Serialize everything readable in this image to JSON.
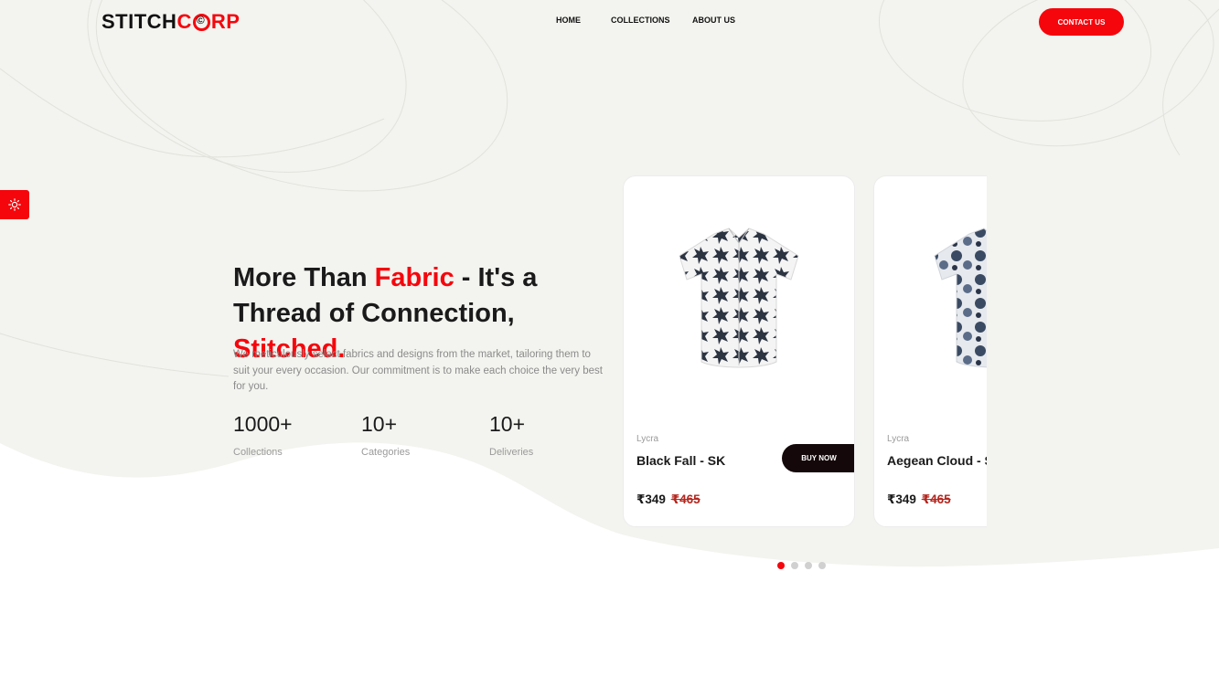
{
  "brand": {
    "logo_left": "STITCH",
    "logo_right_pre": "C",
    "logo_right_post": "RP"
  },
  "nav": {
    "items": [
      "HOME",
      "COLLECTIONS",
      "ABOUT US"
    ],
    "contact_label": "CONTACT US"
  },
  "side_widget": {
    "icon": "sun-icon"
  },
  "hero": {
    "title_part1": "More Than ",
    "title_accent1": "Fabric",
    "title_part2": " - It's a Thread of Connection, ",
    "title_accent2": "Stitched.",
    "description": "We meticulously select fabrics and designs from the market, tailoring them to suit your every occasion. Our commitment is to make each choice the very best for you."
  },
  "stats": [
    {
      "value": "1000+",
      "label": "Collections"
    },
    {
      "value": "10+",
      "label": "Categories"
    },
    {
      "value": "10+",
      "label": "Deliveries"
    }
  ],
  "products": [
    {
      "fabric": "Lycra",
      "name": "Black Fall - SK",
      "price": "₹349",
      "old_price": "₹465",
      "buy_label": "BUY NOW"
    },
    {
      "fabric": "Lycra",
      "name": "Aegean Cloud - SK",
      "price": "₹349",
      "old_price": "₹465"
    }
  ],
  "carousel": {
    "pages": 4,
    "active_page": 1
  },
  "colors": {
    "accent": "#f5060c",
    "dark": "#14080a",
    "bg": "#f3f3ef"
  }
}
